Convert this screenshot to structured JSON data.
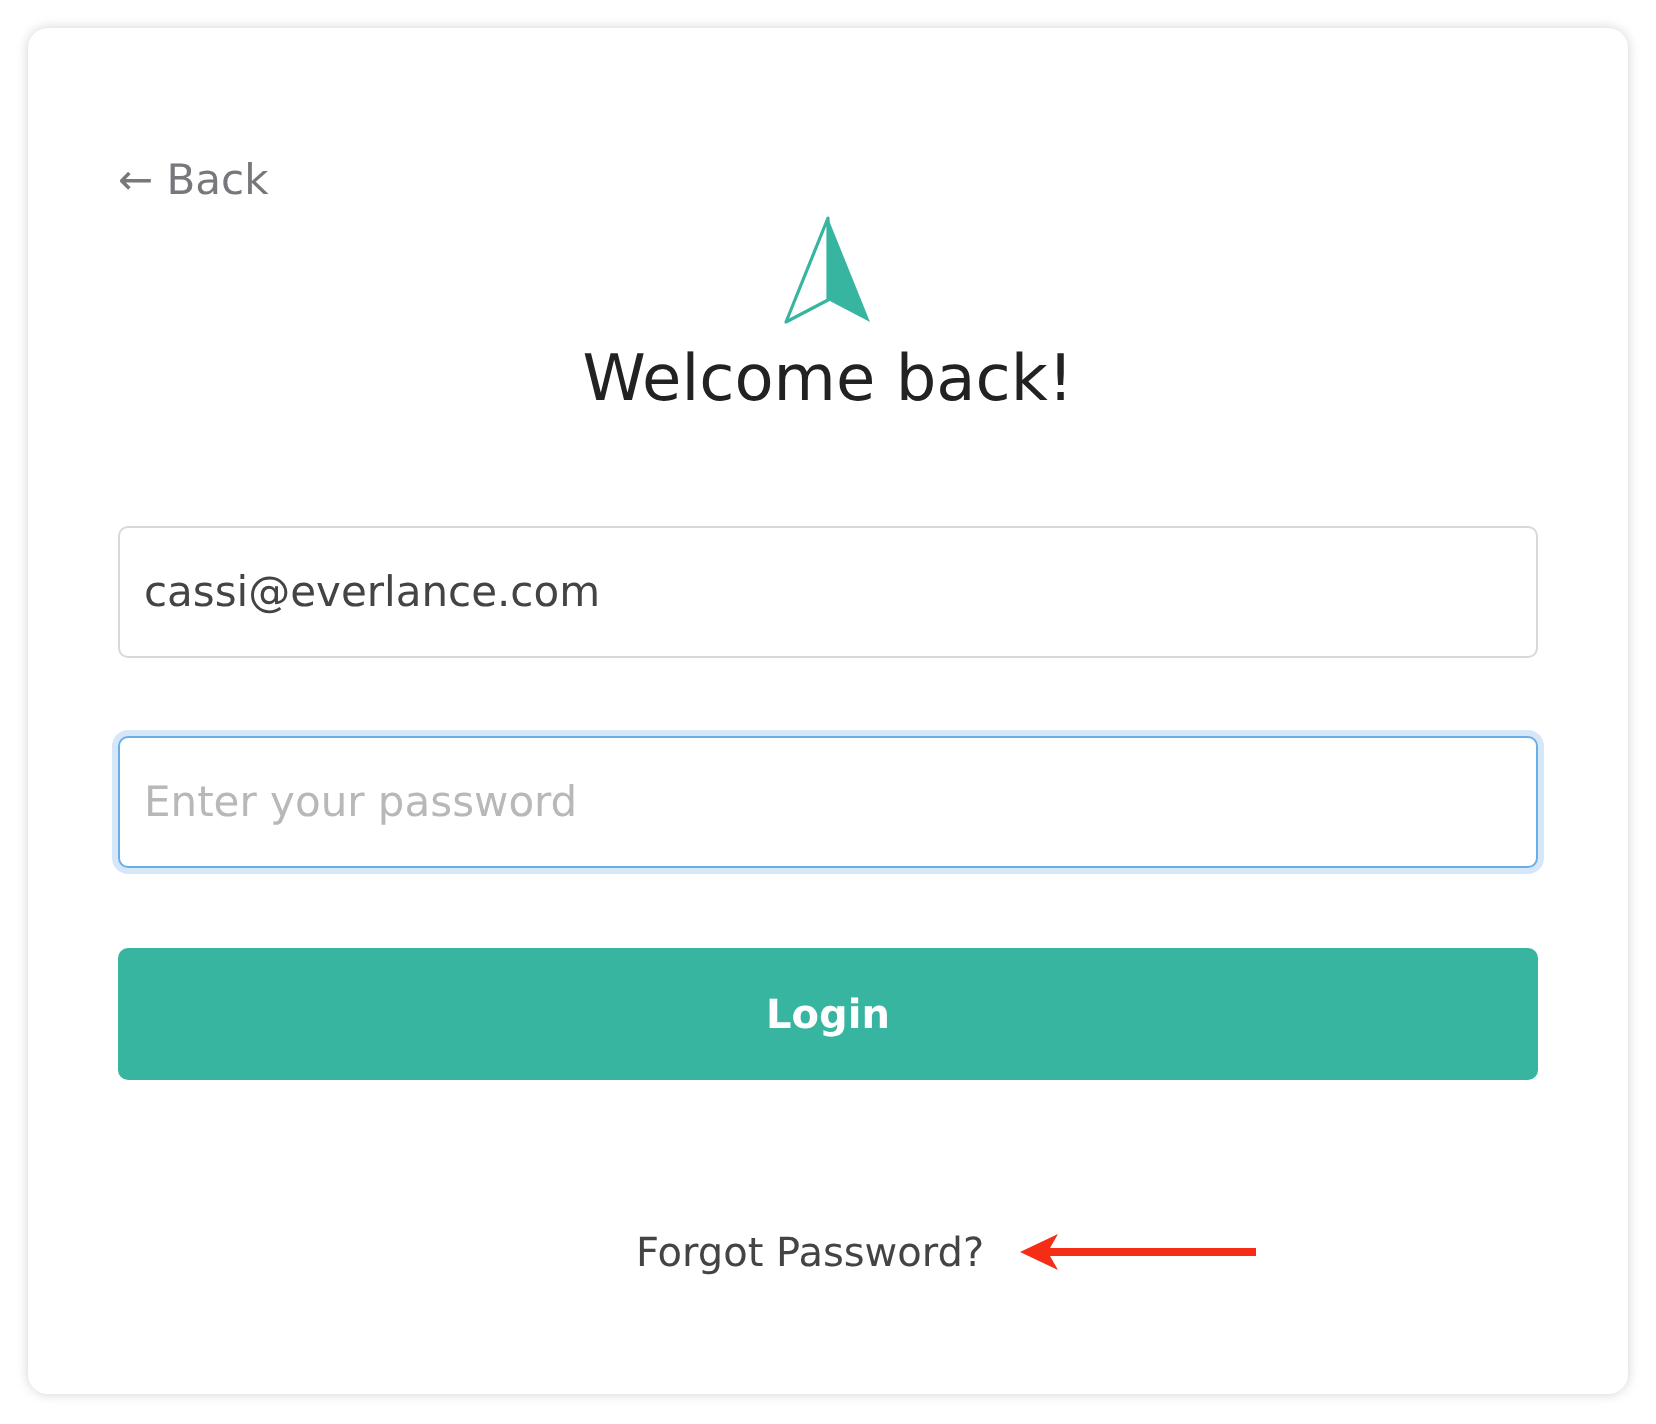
{
  "back_link": {
    "label": "← Back"
  },
  "title": "Welcome back!",
  "fields": [
    {
      "kind": "email",
      "value": "cassi@everlance.com",
      "focused": false
    },
    {
      "kind": "password",
      "placeholder": "Enter your password",
      "focused": true
    }
  ],
  "login_button": {
    "label": "Login"
  },
  "forgot_link": {
    "label": "Forgot Password?"
  }
}
